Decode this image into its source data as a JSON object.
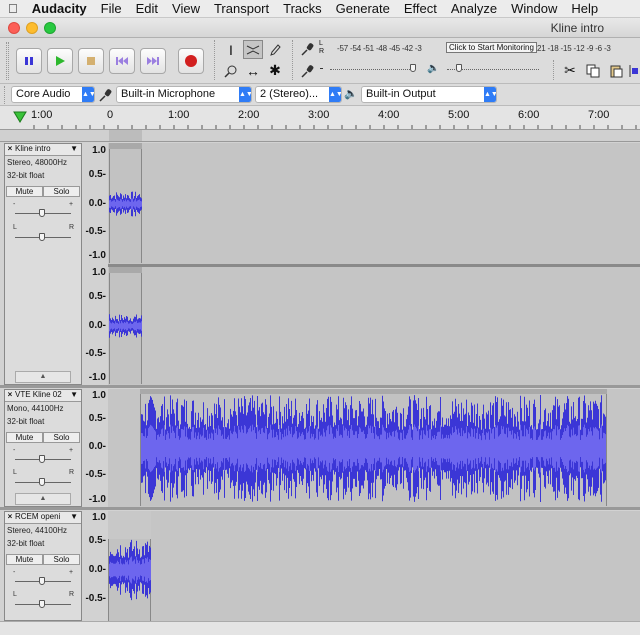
{
  "menubar": {
    "apple_icon": "apple-icon",
    "app_name": "Audacity",
    "items": [
      "File",
      "Edit",
      "View",
      "Transport",
      "Tracks",
      "Generate",
      "Effect",
      "Analyze",
      "Window",
      "Help"
    ]
  },
  "window": {
    "title": "Kline intro"
  },
  "colors": {
    "waveform": "#3b36d6",
    "waveform_light": "#6d66ee",
    "play_green": "#2db82d",
    "record_red": "#d22020",
    "selection_blue": "#2f7cf6"
  },
  "toolbar": {
    "pause_icon": "pause-icon",
    "play_icon": "play-icon",
    "stop_icon": "stop-icon",
    "skip_start_icon": "skip-to-start-icon",
    "skip_end_icon": "skip-to-end-icon",
    "record_icon": "record-icon",
    "tools": [
      "I",
      "Ø",
      "↔",
      "✱"
    ],
    "meter_scale": "-57 -54 -51 -48 -45 -42 -3",
    "monitor_text": "Click to Start Monitoring",
    "meter_scale_right": "21 -18 -15 -12 -9 -6 -3",
    "record_meter_L": "L",
    "record_meter_R": "R"
  },
  "device_bar": {
    "host": "Core Audio",
    "input": "Built-in Microphone",
    "channels": "2 (Stereo)...",
    "output": "Built-in Output"
  },
  "ruler": {
    "ticks": [
      "1:00",
      "0",
      "1:00",
      "2:00",
      "3:00",
      "4:00",
      "5:00",
      "6:00",
      "7:00"
    ]
  },
  "tracks": [
    {
      "name": "Kline intro",
      "info1": "Stereo, 48000Hz",
      "info2": "32-bit float",
      "mute": "Mute",
      "solo": "Solo",
      "gain_minus": "-",
      "gain_plus": "+",
      "pan_L": "L",
      "pan_R": "R",
      "scale": [
        "1.0",
        "0.5-",
        "0.0-",
        "-0.5-",
        "-1.0"
      ],
      "scale2": [
        "1.0",
        "0.5-",
        "0.0-",
        "-0.5-",
        "-1.0"
      ]
    },
    {
      "name": "VTE Kline 02",
      "info1": "Mono, 44100Hz",
      "info2": "32-bit float",
      "mute": "Mute",
      "solo": "Solo",
      "gain_minus": "-",
      "gain_plus": "+",
      "pan_L": "L",
      "pan_R": "R",
      "scale": [
        "1.0",
        "0.5-",
        "0.0-",
        "-0.5-",
        "-1.0"
      ]
    },
    {
      "name": "RCEM openi",
      "info1": "Stereo, 44100Hz",
      "info2": "32-bit float",
      "mute": "Mute",
      "solo": "Solo",
      "gain_minus": "-",
      "gain_plus": "+",
      "pan_L": "L",
      "pan_R": "R",
      "scale": [
        "1.0",
        "0.5-",
        "0.0-",
        "-0.5-"
      ]
    }
  ]
}
